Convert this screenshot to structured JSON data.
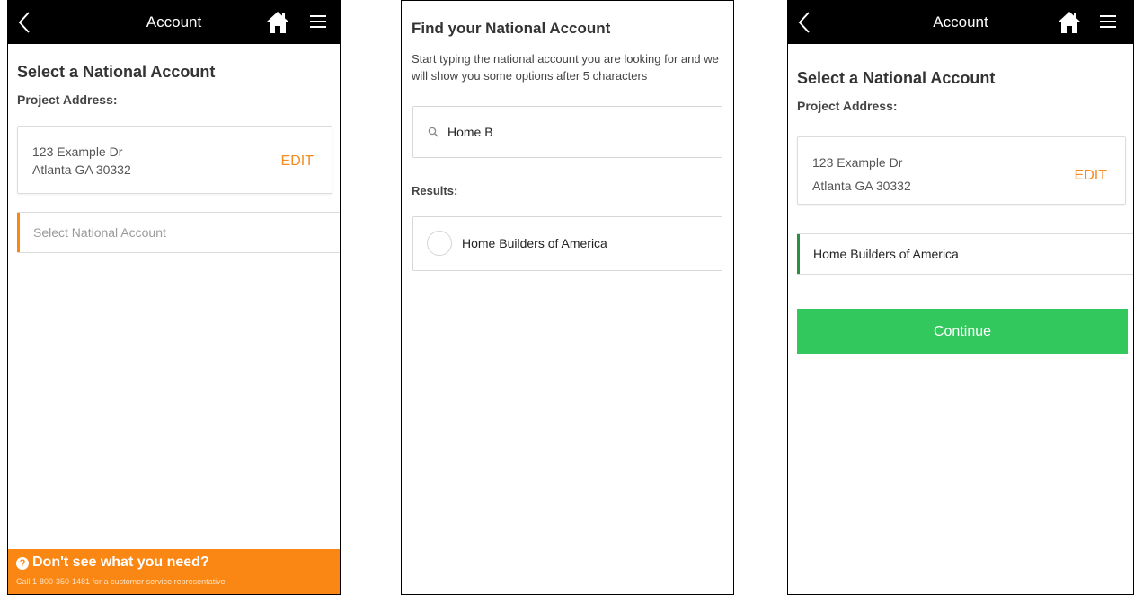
{
  "colors": {
    "topbar": "#000000",
    "accent_orange": "#fa8713",
    "edit_orange": "#f58a1f",
    "success_green": "#33c85e",
    "selected_accent": "#2a8f3e",
    "placeholder_gray": "#9a9a9a"
  },
  "screen1": {
    "topbar": {
      "title": "Account",
      "back_icon": "chevron-left-icon",
      "home_icon": "home-icon",
      "menu_icon": "hamburger-menu-icon"
    },
    "heading": "Select a National Account",
    "project_address_label": "Project Address:",
    "address": {
      "line1": "123 Example Dr",
      "line2": "Atlanta GA 30332",
      "edit_label": "EDIT"
    },
    "select_field": {
      "placeholder": "Select National Account"
    },
    "help": {
      "icon": "question-circle-icon",
      "title": "Don't see what you need?",
      "subtitle": "Call 1-800-350-1481 for a customer service representative"
    }
  },
  "screen2": {
    "title": "Find your National Account",
    "description": "Start typing the national account you are looking for and we will show you some options after 5 characters",
    "search": {
      "icon": "search-icon",
      "value": "Home B"
    },
    "results_label": "Results:",
    "results": [
      {
        "label": "Home Builders of America"
      }
    ]
  },
  "screen3": {
    "topbar": {
      "title": "Account",
      "back_icon": "chevron-left-icon",
      "home_icon": "home-icon",
      "menu_icon": "hamburger-menu-icon"
    },
    "heading": "Select a National Account",
    "project_address_label": "Project Address:",
    "address": {
      "line1": "123 Example Dr",
      "line2": "Atlanta GA 30332",
      "edit_label": "EDIT"
    },
    "selected_account": "Home Builders of America",
    "continue_label": "Continue"
  }
}
